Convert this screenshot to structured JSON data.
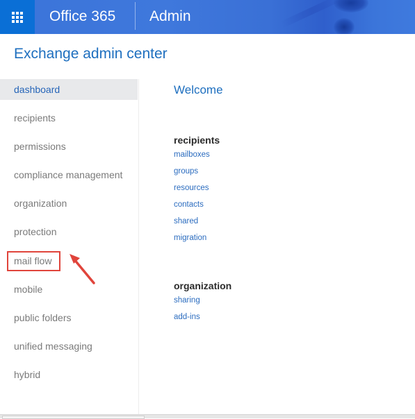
{
  "header": {
    "launcher_icon": "app-launcher-waffle-icon",
    "brand": "Office 365",
    "app_name": "Admin"
  },
  "page": {
    "title": "Exchange admin center"
  },
  "sidebar": {
    "items": [
      {
        "label": "dashboard",
        "active": true
      },
      {
        "label": "recipients",
        "active": false
      },
      {
        "label": "permissions",
        "active": false
      },
      {
        "label": "compliance management",
        "active": false
      },
      {
        "label": "organization",
        "active": false
      },
      {
        "label": "protection",
        "active": false
      },
      {
        "label": "mail flow",
        "active": false,
        "annotated": true
      },
      {
        "label": "mobile",
        "active": false
      },
      {
        "label": "public folders",
        "active": false
      },
      {
        "label": "unified messaging",
        "active": false
      },
      {
        "label": "hybrid",
        "active": false
      }
    ]
  },
  "annotation": {
    "highlight_color": "#e0443b",
    "arrow_icon": "red-arrow-icon"
  },
  "main": {
    "welcome": "Welcome",
    "sections": [
      {
        "heading": "recipients",
        "links": [
          "mailboxes",
          "groups",
          "resources",
          "contacts",
          "shared",
          "migration"
        ]
      },
      {
        "heading": "organization",
        "links": [
          "sharing",
          "add-ins"
        ]
      }
    ]
  },
  "colors": {
    "header_blue": "#3b74d9",
    "launcher_blue": "#0a6fd6",
    "title_blue": "#1e6fbf",
    "link_blue": "#2b6cbf",
    "active_nav_bg": "#e8e9eb"
  }
}
